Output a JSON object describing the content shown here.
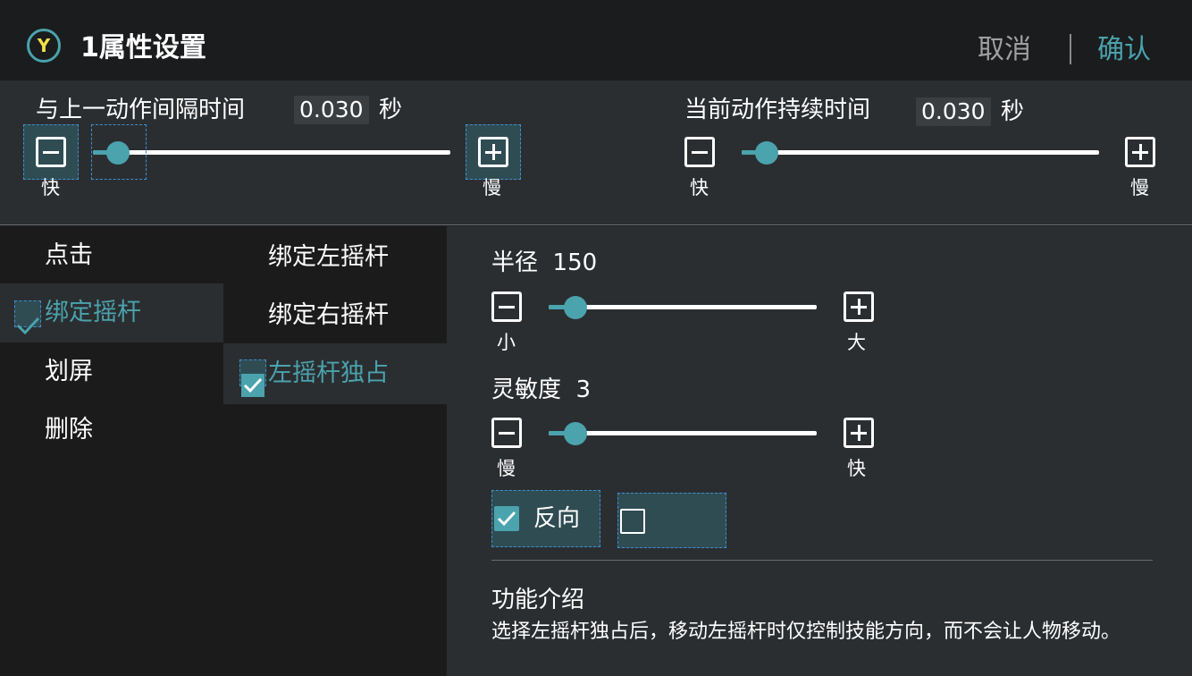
{
  "header": {
    "badge": "Y",
    "title": "1属性设置",
    "cancel_label": "取消",
    "confirm_label": "确认"
  },
  "timing": {
    "interval": {
      "label": "与上一动作间隔时间",
      "value": "0.030",
      "unit": "秒",
      "minus_caption": "快",
      "plus_caption": "慢",
      "level": 0.07
    },
    "duration": {
      "label": "当前动作持续时间",
      "value": "0.030",
      "unit": "秒",
      "minus_caption": "快",
      "plus_caption": "慢",
      "level": 0.07
    }
  },
  "action_menu": [
    {
      "label": "点击",
      "selected": false
    },
    {
      "label": "绑定摇杆",
      "selected": true
    },
    {
      "label": "划屏",
      "selected": false
    },
    {
      "label": "删除",
      "selected": false
    }
  ],
  "joystick_menu": [
    {
      "label": "绑定左摇杆",
      "selected": false
    },
    {
      "label": "绑定右摇杆",
      "selected": false
    },
    {
      "label": "左摇杆独占",
      "selected": true
    }
  ],
  "params": {
    "radius": {
      "label": "半径",
      "value": "150",
      "minus_caption": "小",
      "plus_caption": "大",
      "level": 0.1
    },
    "sensitivity": {
      "label": "灵敏度",
      "value": "3",
      "minus_caption": "慢",
      "plus_caption": "快",
      "level": 0.1
    },
    "reverse_label": "反向",
    "reverse_checked": true,
    "extra_checked": false
  },
  "intro": {
    "title": "功能介绍",
    "text": "选择左摇杆独占后，移动左摇杆时仅控制技能方向，而不会让人物移动。"
  },
  "colors": {
    "accent": "#4aa3ad",
    "badge_letter": "#f2e04a",
    "panel": "#2b2e31",
    "background": "#1b1b1b"
  }
}
